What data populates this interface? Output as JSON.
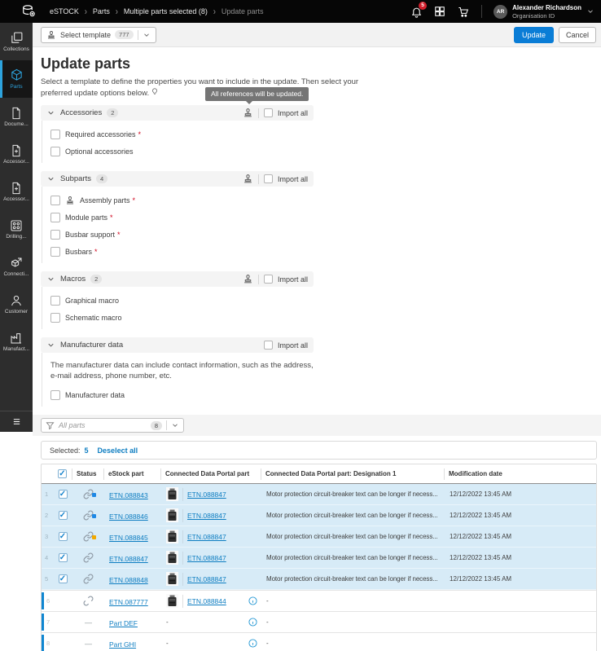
{
  "header": {
    "breadcrumbs": [
      "eSTOCK",
      "Parts",
      "Multiple parts selected (8)",
      "Update parts"
    ],
    "notification_badge": "5",
    "user": {
      "initials": "AR",
      "name": "Alexander Richardson",
      "subtitle": "Organisation ID"
    }
  },
  "sidebar": {
    "items": [
      {
        "label": "Collections"
      },
      {
        "label": "Parts"
      },
      {
        "label": "Docume..."
      },
      {
        "label": "Accessor..."
      },
      {
        "label": "Accessor..."
      },
      {
        "label": "Drilling..."
      },
      {
        "label": "Connecti..."
      },
      {
        "label": "Customer"
      },
      {
        "label": "Manufact..."
      }
    ]
  },
  "toolbar": {
    "select_template": "Select template",
    "template_badge": "777",
    "update": "Update",
    "cancel": "Cancel"
  },
  "page": {
    "title": "Update parts",
    "description": "Select a template to define the properties you want to include in the update. Then select your preferred update options below.",
    "tooltip": "All references will be updated."
  },
  "sections": {
    "accessories": {
      "title": "Accessories",
      "badge": "2",
      "import_all": "Import all",
      "items": [
        {
          "label": "Required accessories"
        },
        {
          "label": "Optional accessories"
        }
      ]
    },
    "subparts": {
      "title": "Subparts",
      "badge": "4",
      "import_all": "Import all",
      "items": [
        {
          "label": "Assembly parts"
        },
        {
          "label": "Module parts"
        },
        {
          "label": "Busbar support"
        },
        {
          "label": "Busbars"
        }
      ]
    },
    "macros": {
      "title": "Macros",
      "badge": "2",
      "import_all": "Import all",
      "items": [
        {
          "label": "Graphical macro"
        },
        {
          "label": "Schematic macro"
        }
      ]
    },
    "manufacturer": {
      "title": "Manufacturer data",
      "import_all": "Import all",
      "description": "The manufacturer data can include contact information, such as the address, e-mail address, phone number, etc.",
      "items": [
        {
          "label": "Manufacturer data"
        }
      ]
    }
  },
  "filter": {
    "placeholder": "All parts",
    "badge": "8"
  },
  "selection": {
    "label": "Selected:",
    "count": "5",
    "deselect": "Deselect all"
  },
  "table": {
    "columns": {
      "status": "Status",
      "estock": "eStock part",
      "portal": "Connected Data Portal part",
      "designation": "Connected Data Portal part: Designation 1",
      "modified": "Modification date"
    },
    "no_status": "—",
    "rows": [
      {
        "num": "1",
        "estock": "ETN.088843",
        "portal": "ETN.088847",
        "designation": "Motor protection circuit-breaker text can be longer if necess...",
        "modified": "12/12/2022 13:45 AM"
      },
      {
        "num": "2",
        "estock": "ETN.088846",
        "portal": "ETN.088847",
        "designation": "Motor protection circuit-breaker text can be longer if necess...",
        "modified": "12/12/2022 13:45 AM"
      },
      {
        "num": "3",
        "estock": "ETN.088845",
        "portal": "ETN.088847",
        "designation": "Motor protection circuit-breaker text can be longer if necess...",
        "modified": "12/12/2022 13:45 AM"
      },
      {
        "num": "4",
        "estock": "ETN.088847",
        "portal": "ETN.088847",
        "designation": "Motor protection circuit-breaker text can be longer if necess...",
        "modified": "12/12/2022 13:45 AM"
      },
      {
        "num": "5",
        "estock": "ETN.088848",
        "portal": "ETN.088847",
        "designation": "Motor protection circuit-breaker text can be longer if necess...",
        "modified": "12/12/2022 13:45 AM"
      },
      {
        "num": "6",
        "estock": "ETN.087777",
        "portal": "ETN.088844",
        "designation": "-",
        "modified": ""
      },
      {
        "num": "7",
        "estock": "Part DEF",
        "portal": "-",
        "designation": "-",
        "modified": ""
      },
      {
        "num": "8",
        "estock": "Part GHI",
        "portal": "-",
        "designation": "-",
        "modified": ""
      }
    ]
  },
  "colors": {
    "accent_blue": "#0a7dd6",
    "link_blue": "#0d7dc1",
    "selected_row": "#d7ebf7",
    "status_dot_blue": "#1e88e5",
    "status_dot_yellow": "#f2a900",
    "badge_red": "#d21f2c"
  }
}
